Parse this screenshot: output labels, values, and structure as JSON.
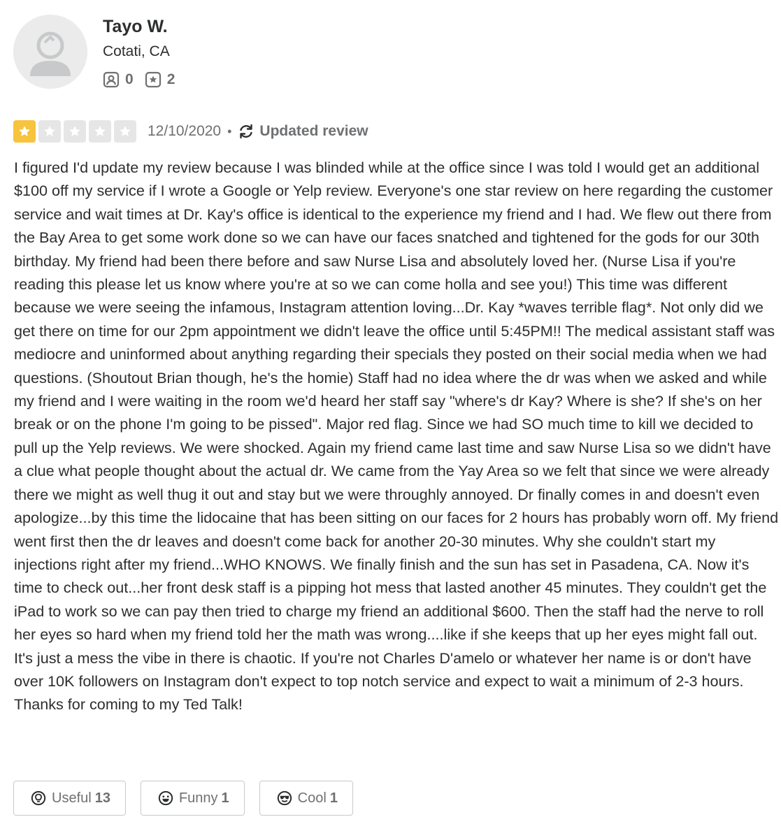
{
  "user": {
    "name": "Tayo W.",
    "location": "Cotati, CA",
    "friends_count": "0",
    "reviews_count": "2"
  },
  "review": {
    "rating": 1,
    "max_rating": 5,
    "date": "12/10/2020",
    "separator": "•",
    "updated_label": "Updated review",
    "text": "I figured I'd update my review because I was blinded while at the office since I was told I would get an additional $100 off my service if I wrote a Google or Yelp review. Everyone's one star review on here regarding the customer service and wait times at Dr. Kay's office is identical to the experience my friend and I had. We flew out there from the Bay Area to get some work done so we can have our faces snatched and tightened for the gods for our 30th birthday. My friend had been there before and saw Nurse Lisa and absolutely loved her. (Nurse Lisa if you're reading this please let us know where you're at so we can come holla and see you!) This time was different because we were seeing the infamous, Instagram attention loving...Dr. Kay *waves terrible flag*. Not only did we get there on time for our 2pm appointment we didn't leave the office until 5:45PM!! The medical assistant staff was mediocre and uninformed about anything regarding their specials they posted on their social media when we had questions. (Shoutout Brian though, he's the homie) Staff had no idea where the dr was when we asked and while my friend and I were waiting in the room we'd heard her staff say \"where's dr Kay? Where is she? If she's on her break or on the phone I'm going to be pissed\". Major red flag. Since we had SO much time to kill we decided to pull up the Yelp reviews. We were shocked. Again my friend came last time and saw Nurse Lisa so we didn't have a clue what people thought about the actual dr. We came from the Yay Area so we felt that since we were already there we might as well thug it out and stay but we were throughly annoyed. Dr finally comes in and doesn't even apologize...by this time the lidocaine that has been sitting on our faces for 2 hours has probably worn off. My friend went first then the dr leaves and doesn't come back for another 20-30 minutes. Why she couldn't start my injections right after my friend...WHO KNOWS. We finally finish and the sun has set in Pasadena, CA. Now it's time to check out...her front desk staff is a pipping hot mess that lasted another 45 minutes. They couldn't get the iPad to work so we can pay then tried to charge my friend an additional $600. Then the staff had the nerve to roll her eyes so hard when my friend told her the math was wrong....like if she keeps that up her eyes might fall out. It's just a mess the vibe in there is chaotic. If you're not Charles D'amelo or whatever her name is or don't have over 10K followers on Instagram don't expect to top notch service and expect to wait a minimum of 2-3 hours. Thanks for coming to my Ted Talk!"
  },
  "reactions": {
    "useful": {
      "label": "Useful",
      "count": "13",
      "icon": "lightbulb-icon"
    },
    "funny": {
      "label": "Funny",
      "count": "1",
      "icon": "smile-icon"
    },
    "cool": {
      "label": "Cool",
      "count": "1",
      "icon": "sunglasses-icon"
    }
  },
  "colors": {
    "star_filled": "#f7c43d",
    "star_empty": "#e6e6e6",
    "text_primary": "#2d2e2f",
    "text_secondary": "#6e7072",
    "button_border": "#c8c9ca"
  }
}
